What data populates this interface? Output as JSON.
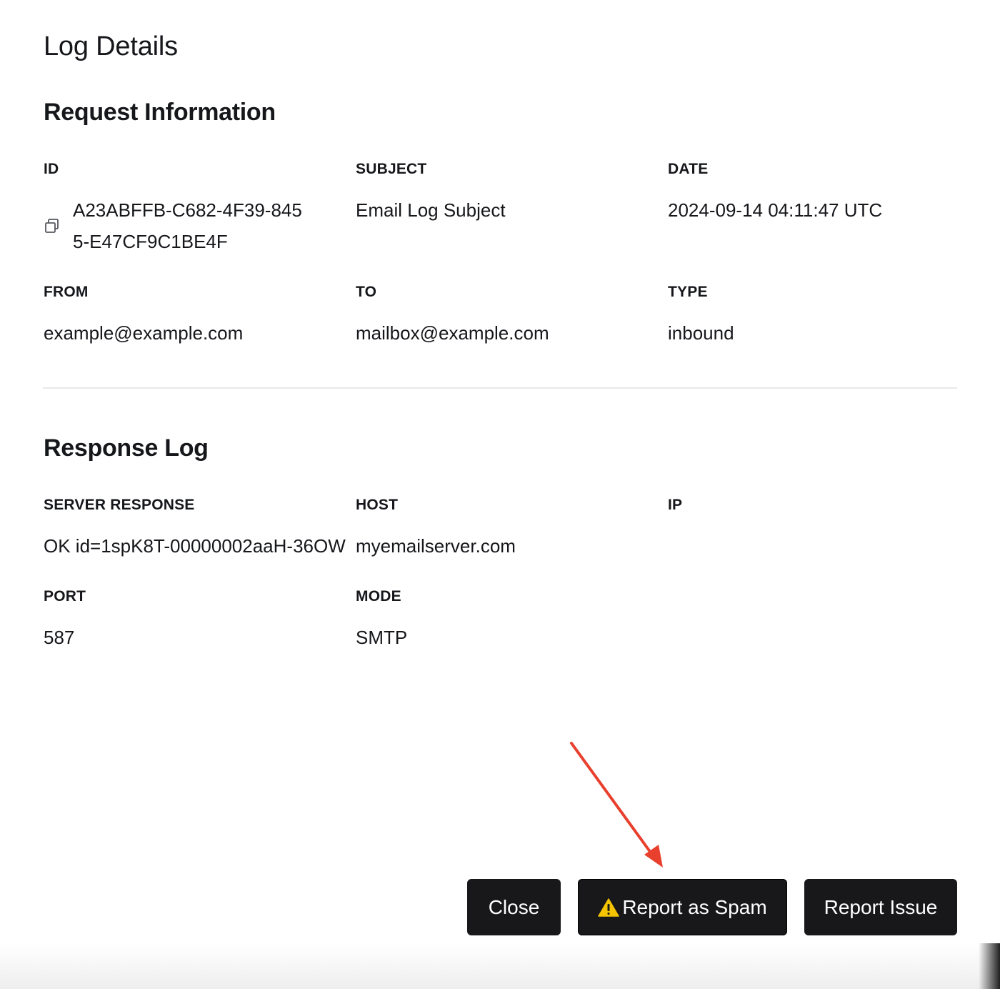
{
  "dialog": {
    "title": "Log Details"
  },
  "request": {
    "section_title": "Request Information",
    "id": {
      "label": "ID",
      "value": "A23ABFFB-C682-4F39-8455-E47CF9C1BE4F"
    },
    "subject": {
      "label": "SUBJECT",
      "value": "Email Log Subject"
    },
    "date": {
      "label": "DATE",
      "value": "2024-09-14 04:11:47 UTC"
    },
    "from": {
      "label": "FROM",
      "value": "example@example.com"
    },
    "to": {
      "label": "TO",
      "value": "mailbox@example.com"
    },
    "type": {
      "label": "TYPE",
      "value": "inbound"
    }
  },
  "response": {
    "section_title": "Response Log",
    "server_response": {
      "label": "SERVER RESPONSE",
      "value": "OK id=1spK8T-00000002aaH-36OW"
    },
    "host": {
      "label": "HOST",
      "value": "myemailserver.com"
    },
    "ip": {
      "label": "IP",
      "value": ""
    },
    "port": {
      "label": "PORT",
      "value": "587"
    },
    "mode": {
      "label": "MODE",
      "value": "SMTP"
    }
  },
  "footer": {
    "close_label": "Close",
    "spam_label": "Report as Spam",
    "issue_label": "Report Issue"
  },
  "icons": {
    "copy": "copy-icon",
    "warning": "warning-icon"
  },
  "colors": {
    "button_bg": "#18181b",
    "button_text": "#ffffff",
    "divider": "#e7e8ea",
    "annotation_arrow": "#e8402d",
    "warning": "#f5c400"
  }
}
